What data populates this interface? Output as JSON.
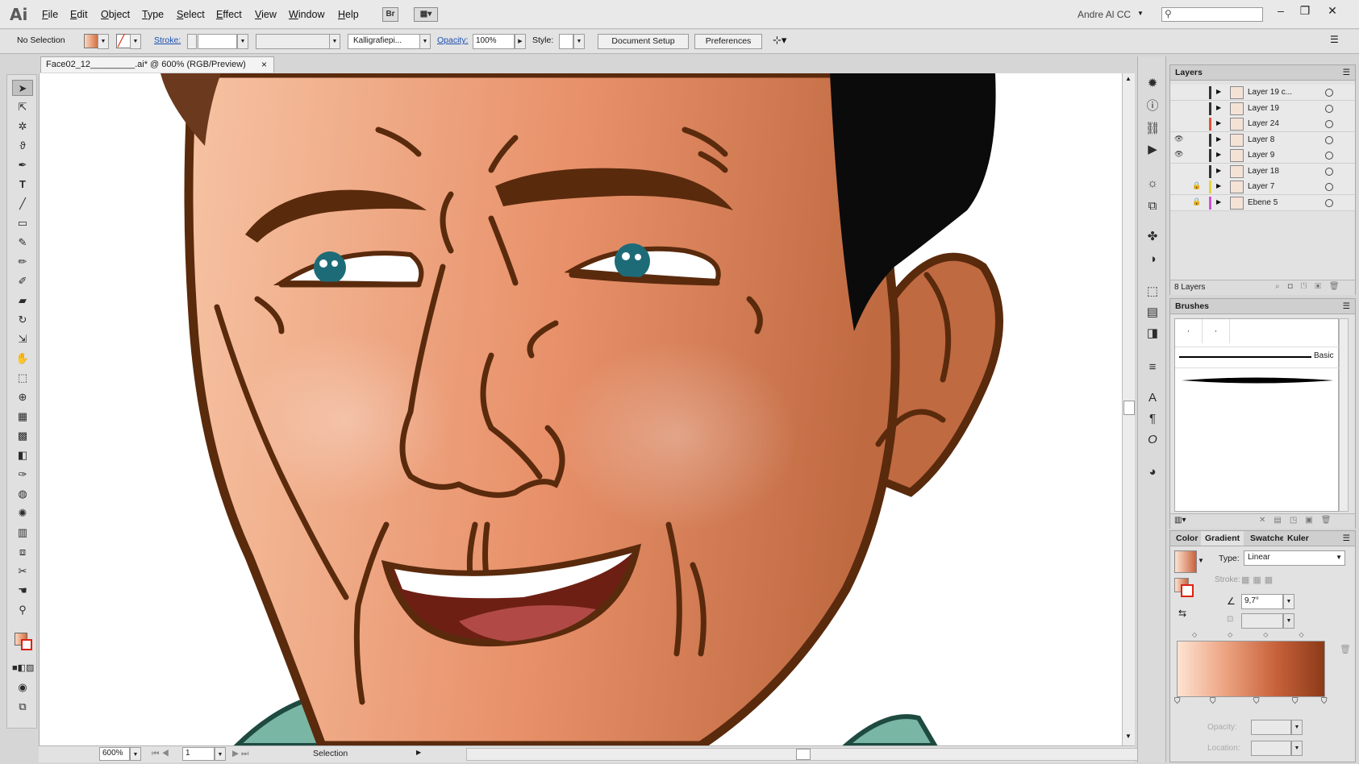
{
  "app": {
    "logo": "Ai"
  },
  "menu": [
    "File",
    "Edit",
    "Object",
    "Type",
    "Select",
    "Effect",
    "View",
    "Window",
    "Help"
  ],
  "menubar": {
    "bridge_label": "Br",
    "user": "Andre Al CC",
    "search_placeholder": ""
  },
  "controlbar": {
    "selection": "No Selection",
    "stroke_label": "Stroke:",
    "brush": "Kalligrafiepi...",
    "opacity_label": "Opacity:",
    "opacity_value": "100%",
    "style_label": "Style:",
    "document_setup": "Document Setup",
    "preferences": "Preferences"
  },
  "document": {
    "tab_title": "Face02_12_________.ai* @ 600% (RGB/Preview)",
    "close": "×",
    "zoom": "600%",
    "page": "1",
    "status": "Selection"
  },
  "layers_panel": {
    "title": "Layers",
    "count": "8 Layers",
    "layers": [
      {
        "name": "Layer 19 c...",
        "visible": false,
        "locked": false,
        "color": "#333333"
      },
      {
        "name": "Layer 19",
        "visible": false,
        "locked": false,
        "color": "#333333"
      },
      {
        "name": "Layer 24",
        "visible": false,
        "locked": false,
        "color": "#e0533a"
      },
      {
        "name": "Layer 8",
        "visible": true,
        "locked": false,
        "color": "#333333"
      },
      {
        "name": "Layer 9",
        "visible": true,
        "locked": false,
        "color": "#333333"
      },
      {
        "name": "Layer 18",
        "visible": false,
        "locked": false,
        "color": "#333333"
      },
      {
        "name": "Layer 7",
        "visible": false,
        "locked": true,
        "color": "#e3d63a"
      },
      {
        "name": "Ebene 5",
        "visible": false,
        "locked": true,
        "color": "#d24fd8"
      }
    ]
  },
  "brushes_panel": {
    "title": "Brushes",
    "basic_label": "Basic"
  },
  "gradient_panel": {
    "tabs": [
      "Color",
      "Gradient",
      "Swatches",
      "Kuler"
    ],
    "active_tab": "Gradient",
    "type_label": "Type:",
    "type_value": "Linear",
    "stroke_label": "Stroke:",
    "angle": "9,7°",
    "opacity_label": "Opacity:",
    "location_label": "Location:",
    "gradient_colors": [
      "#fde3d2",
      "#eca27f",
      "#c8623c",
      "#8c3a18"
    ]
  },
  "colors": {
    "skin_light": "#f6c3a3",
    "skin_mid": "#e8916a",
    "skin_dark": "#c06a42",
    "outline": "#5a2a0d",
    "hair": "#0b0b0b",
    "eye": "#1e6b78",
    "mouth": "#b14a46",
    "collar": "#7ab6a4"
  }
}
